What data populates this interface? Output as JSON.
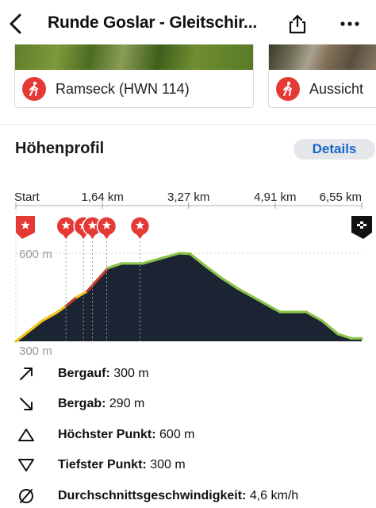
{
  "header": {
    "title": "Runde Goslar - Gleitschir...",
    "back_icon": "chevron-left-icon",
    "share_icon": "share-icon",
    "more_icon": "more-horizontal-icon"
  },
  "cards": [
    {
      "label": "Ramseck (HWN 114)",
      "icon": "hiking-pin-icon"
    },
    {
      "label": "Aussicht",
      "icon": "hiking-pin-icon"
    }
  ],
  "elevation": {
    "title": "Höhenprofil",
    "details_label": "Details",
    "colors": {
      "low": "#f0c419",
      "mid": "#8bc34a",
      "steep": "#c0392b",
      "fill": "#1b2433",
      "marker": "#e53935"
    }
  },
  "chart_data": {
    "type": "area",
    "x_unit": "km",
    "x_ticks": [
      "Start",
      "1,64 km",
      "3,27 km",
      "4,91 km",
      "6,55 km"
    ],
    "x_tick_values": [
      0,
      1.64,
      3.27,
      4.91,
      6.55
    ],
    "y_labels": [
      "600 m",
      "300 m"
    ],
    "ylim": [
      300,
      600
    ],
    "xlim": [
      0,
      6.55
    ],
    "series": [
      {
        "x": [
          0,
          0.25,
          0.5,
          0.75,
          0.95,
          1.15,
          1.35,
          1.55,
          1.75,
          2.0,
          2.4,
          2.8,
          3.1,
          3.3,
          3.6,
          3.9,
          4.2,
          4.5,
          4.8,
          5.0,
          5.3,
          5.5,
          5.8,
          6.1,
          6.35,
          6.55
        ],
        "y": [
          300,
          335,
          370,
          395,
          420,
          450,
          470,
          510,
          550,
          565,
          565,
          585,
          600,
          598,
          555,
          515,
          480,
          450,
          420,
          400,
          400,
          400,
          370,
          325,
          310,
          310
        ]
      }
    ],
    "markers_km": [
      0,
      0.95,
      1.28,
      1.45,
      1.72,
      2.35,
      6.55
    ]
  },
  "stats": [
    {
      "label": "Bergauf:",
      "value": "300 m",
      "icon": "arrow-up-right-icon"
    },
    {
      "label": "Bergab:",
      "value": "290 m",
      "icon": "arrow-down-right-icon"
    },
    {
      "label": "Höchster Punkt:",
      "value": "600 m",
      "icon": "triangle-up-icon"
    },
    {
      "label": "Tiefster Punkt:",
      "value": "300 m",
      "icon": "triangle-down-icon"
    },
    {
      "label": "Durchschnittsgeschwindigkeit:",
      "value": "4,6 km/h",
      "icon": "average-icon"
    }
  ]
}
